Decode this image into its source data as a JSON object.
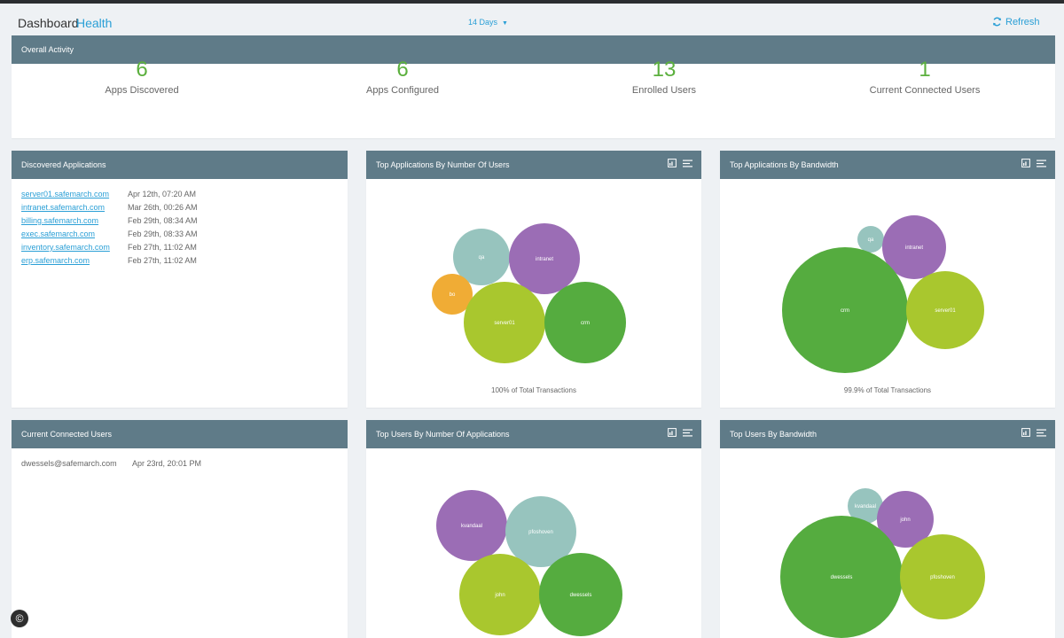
{
  "header": {
    "title": "Dashboard",
    "subtitle": "Health",
    "range_label": "14 Days",
    "refresh_label": "Refresh"
  },
  "overall": {
    "title": "Overall Activity",
    "stats": [
      {
        "value": "6",
        "label": "Apps Discovered"
      },
      {
        "value": "6",
        "label": "Apps Configured"
      },
      {
        "value": "13",
        "label": "Enrolled Users"
      },
      {
        "value": "1",
        "label": "Current Connected Users"
      }
    ]
  },
  "discovered": {
    "title": "Discovered Applications",
    "rows": [
      {
        "host": "server01.safemarch.com",
        "date": "Apr 12th, 07:20 AM"
      },
      {
        "host": "intranet.safemarch.com",
        "date": "Mar 26th, 00:26 AM"
      },
      {
        "host": "billing.safemarch.com",
        "date": "Feb 29th, 08:34 AM"
      },
      {
        "host": "exec.safemarch.com",
        "date": "Feb 29th, 08:33 AM"
      },
      {
        "host": "inventory.safemarch.com",
        "date": "Feb 27th, 11:02 AM"
      },
      {
        "host": "erp.safemarch.com",
        "date": "Feb 27th, 11:02 AM"
      }
    ]
  },
  "connected": {
    "title": "Current Connected Users",
    "rows": [
      {
        "user": "dwessels@safemarch.com",
        "date": "Apr 23rd, 20:01 PM"
      }
    ]
  },
  "charts": {
    "apps_by_users": {
      "title": "Top Applications By Number Of Users",
      "caption": "100% of Total Transactions"
    },
    "apps_by_bandwidth": {
      "title": "Top Applications By Bandwidth",
      "caption": "99.9% of Total Transactions"
    },
    "users_by_apps": {
      "title": "Top Users By Number Of Applications"
    },
    "users_by_bandwidth": {
      "title": "Top Users By Bandwidth"
    }
  },
  "bubble_labels": {
    "c1": [
      "qa",
      "intranet",
      "bo",
      "server01",
      "crm"
    ],
    "c2": [
      "qa",
      "intranet",
      "crm",
      "server01"
    ],
    "c3": [
      "kvandaal",
      "pfoshoven",
      "john",
      "dwessels"
    ],
    "c4": [
      "kvandaal",
      "john",
      "dwessels",
      "pfoshoven"
    ]
  },
  "colors": {
    "accent": "#2a9fd6",
    "panel_header": "#5f7b88",
    "stat_green": "#5cb03e",
    "bubble_teal": "#97c4be",
    "bubble_purple": "#9b6db5",
    "bubble_orange": "#f0ac35",
    "bubble_lime": "#a9c72e",
    "bubble_green": "#55ac3f"
  },
  "icons": {
    "export": "export-icon",
    "menu": "menu-lines-icon",
    "refresh": "refresh-icon",
    "dropdown": "caret-down-icon",
    "copyright": "copyright-icon"
  },
  "footer": {
    "badge": "©"
  }
}
